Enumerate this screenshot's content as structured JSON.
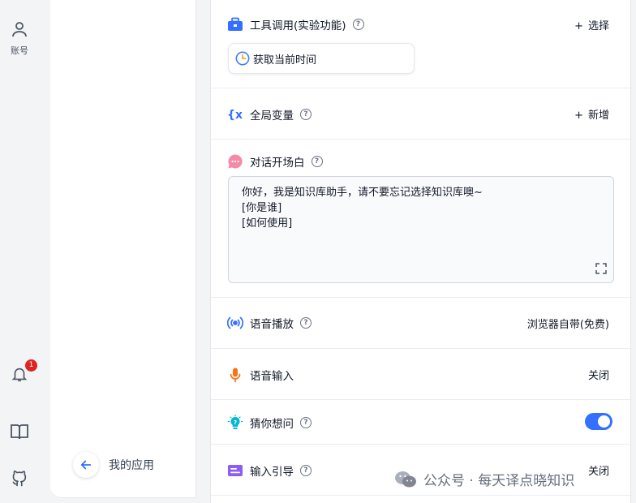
{
  "rail": {
    "account_label": "账号",
    "notification_count": "1"
  },
  "panel": {
    "my_app_label": "我的应用"
  },
  "tools": {
    "title": "工具调用(实验功能)",
    "action": "选择",
    "chip_label": "获取当前时间"
  },
  "variables": {
    "title": "全局变量",
    "action": "新增"
  },
  "opening": {
    "title": "对话开场白",
    "lines": [
      "你好，我是知识库助手，请不要忘记选择知识库噢~",
      "[你是谁]",
      "[如何使用]"
    ]
  },
  "tts": {
    "title": "语音播放",
    "value": "浏览器自带(免费)"
  },
  "voice_input": {
    "title": "语音输入",
    "value": "关闭"
  },
  "guess": {
    "title": "猜你想问",
    "enabled": true
  },
  "input_guide": {
    "title": "输入引导",
    "value": "关闭"
  },
  "watermark": {
    "text": "公众号 · 每天译点晓知识"
  },
  "colors": {
    "accent": "#3370ff",
    "badge": "#e02424"
  }
}
